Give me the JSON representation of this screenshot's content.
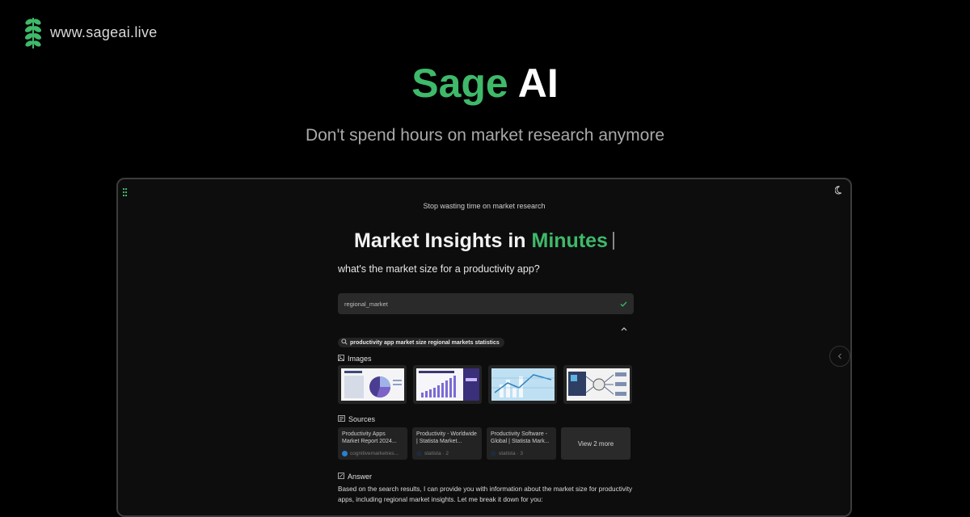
{
  "site": {
    "url": "www.sageai.live"
  },
  "hero": {
    "title_accent": "Sage",
    "title_rest": "AI",
    "subtitle": "Don't spend hours on market research anymore"
  },
  "app": {
    "tagline": "Stop wasting time on market research",
    "title_main": "Market Insights in",
    "title_accent": "Minutes",
    "query": "what's the market size for a productivity app?",
    "tool_label": "regional_market",
    "search_query": "productivity app market size regional markets statistics",
    "images_label": "Images",
    "sources_label": "Sources",
    "sources": [
      {
        "title": "Productivity Apps Market Report 2024...",
        "meta": "cognitivemarketres..."
      },
      {
        "title": "Productivity - Worldwide | Statista Market...",
        "meta": "statista · 2"
      },
      {
        "title": "Productivity Software - Global | Statista Mark...",
        "meta": "statista · 3"
      }
    ],
    "view_more": "View 2 more",
    "answer_label": "Answer",
    "answer_text": "Based on the search results, I can provide you with information about the market size for productivity apps, including regional market insights. Let me break it down for you:"
  },
  "colors": {
    "accent": "#3fb96a",
    "background": "#000000",
    "panel": "#0d0d0d"
  },
  "icons": [
    "leaf-logo-icon",
    "menu-icon",
    "theme-toggle-icon",
    "check-icon",
    "chevron-up-icon",
    "search-icon",
    "image-icon",
    "sources-icon",
    "answer-icon",
    "chevron-left-icon"
  ]
}
